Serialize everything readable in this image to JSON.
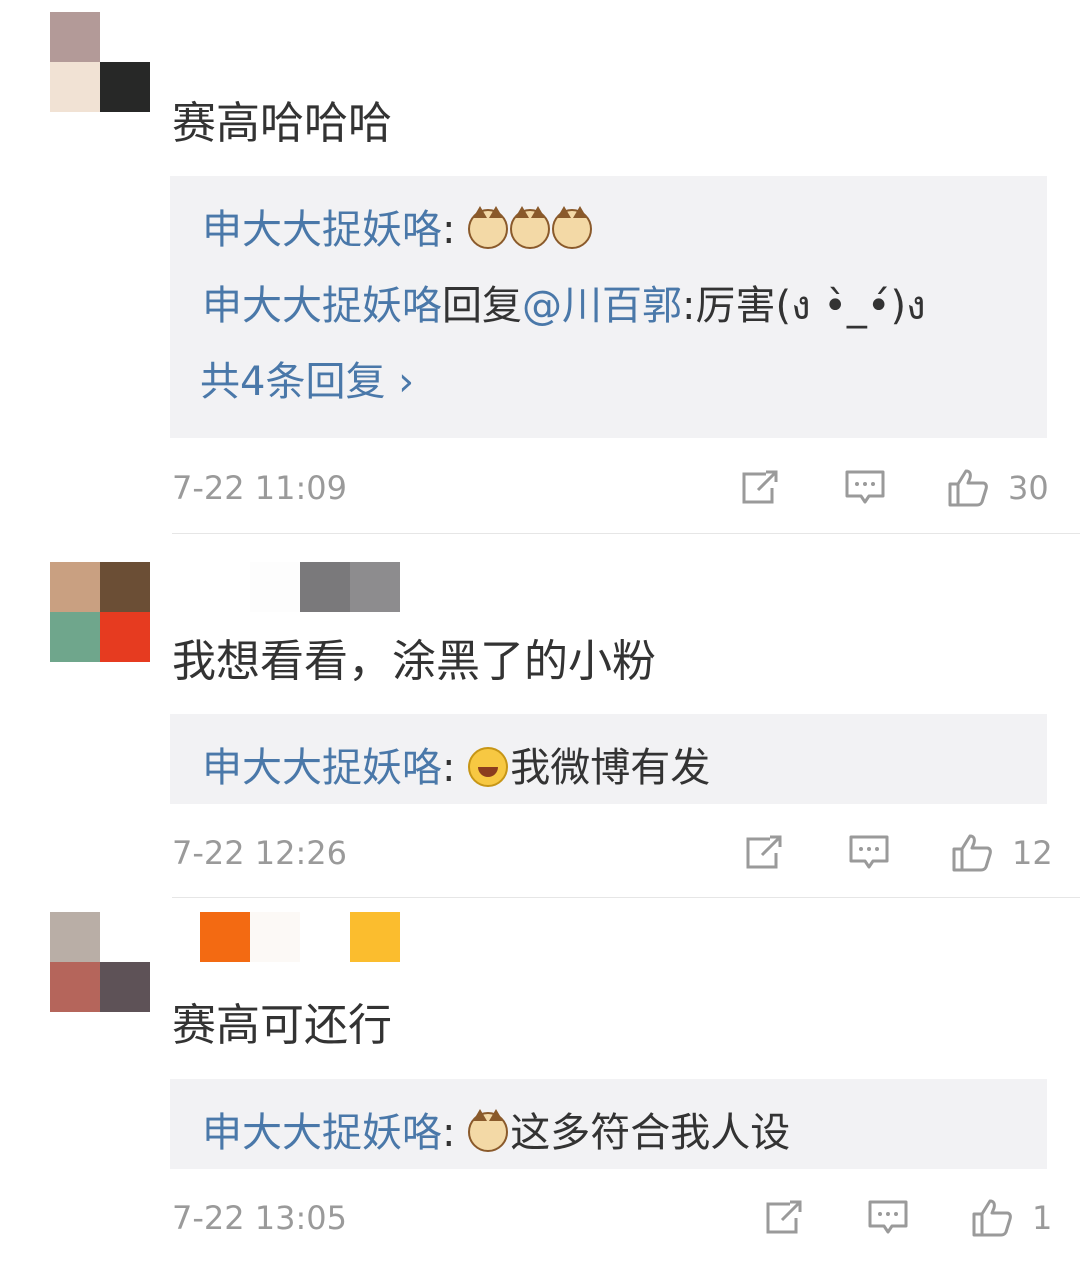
{
  "comments": [
    {
      "text": "赛高哈哈哈",
      "replies": [
        {
          "author": "申大大捉妖咯",
          "sep": ": ",
          "emojis": [
            "cat-face-emoji",
            "cat-face-emoji",
            "cat-face-emoji"
          ],
          "body": ""
        },
        {
          "author": "申大大捉妖咯",
          "reply_word": "回复",
          "mention": "@川百郭",
          "sep": ":",
          "body": "厉害(ง •̀_•́)ง"
        }
      ],
      "more_replies": "共4条回复 ›",
      "time": "7-22 11:09",
      "likes": "30"
    },
    {
      "text": "我想看看，涂黑了的小粉",
      "replies": [
        {
          "author": "申大大捉妖咯",
          "sep": ": ",
          "emojis": [
            "laughing-emoji"
          ],
          "body": "我微博有发"
        }
      ],
      "time": "7-22 12:26",
      "likes": "12"
    },
    {
      "text": "赛高可还行",
      "replies": [
        {
          "author": "申大大捉妖咯",
          "sep": ": ",
          "emojis": [
            "cat-face-emoji"
          ],
          "body": "这多符合我人设"
        }
      ],
      "time": "7-22 13:05",
      "likes": "1"
    }
  ],
  "icons": {
    "share": "share-icon",
    "reply": "comment-icon",
    "like": "thumbs-up-icon"
  },
  "colors": {
    "author_link": "#4a78a9",
    "reply_bg": "#f2f2f4",
    "meta_text": "#9a9a9a"
  }
}
